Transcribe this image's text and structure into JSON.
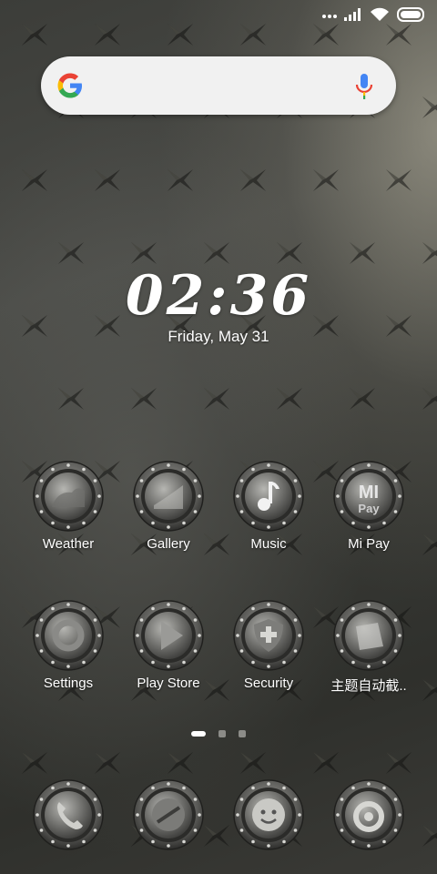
{
  "status_bar": {
    "icons": [
      "more-dots-icon",
      "signal-icon",
      "wifi-icon",
      "battery-icon"
    ]
  },
  "search": {
    "logo": "google-logo",
    "mic": "mic-icon"
  },
  "clock": {
    "time": "02:36",
    "date": "Friday, May 31"
  },
  "apps": [
    {
      "label": "Weather",
      "icon": "weather-icon"
    },
    {
      "label": "Gallery",
      "icon": "gallery-icon"
    },
    {
      "label": "Music",
      "icon": "music-icon"
    },
    {
      "label": "Mi Pay",
      "icon": "mi-pay-icon"
    },
    {
      "label": "Settings",
      "icon": "settings-icon"
    },
    {
      "label": "Play Store",
      "icon": "play-store-icon"
    },
    {
      "label": "Security",
      "icon": "security-icon"
    },
    {
      "label": "主题自动截..",
      "icon": "theme-icon"
    }
  ],
  "dock": [
    {
      "icon": "phone-icon"
    },
    {
      "icon": "messages-icon"
    },
    {
      "icon": "chat-icon"
    },
    {
      "icon": "camera-icon"
    }
  ],
  "pager": {
    "count": 3,
    "active": 1
  }
}
